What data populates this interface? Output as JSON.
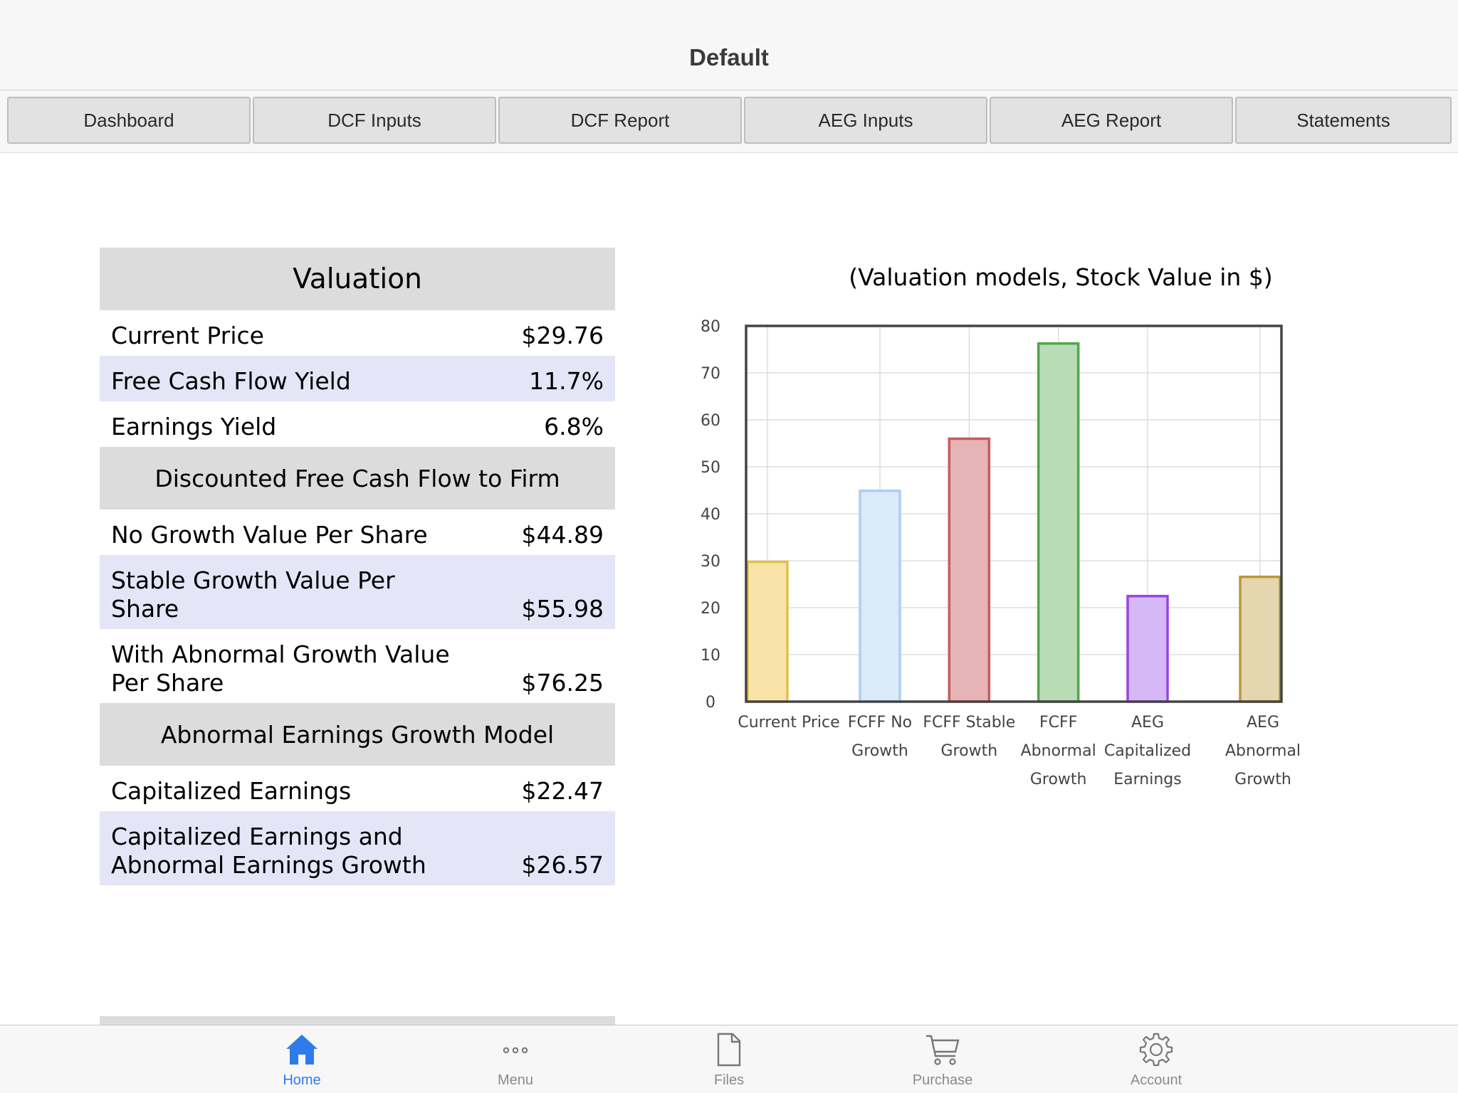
{
  "header": {
    "title": "Default"
  },
  "tabs": [
    {
      "label": "Dashboard"
    },
    {
      "label": "DCF Inputs"
    },
    {
      "label": "DCF Report"
    },
    {
      "label": "AEG Inputs"
    },
    {
      "label": "AEG Report"
    },
    {
      "label": "Statements"
    }
  ],
  "valuation": {
    "title": "Valuation",
    "current_price": {
      "label": "Current Price",
      "value": "$29.76"
    },
    "fcf_yield": {
      "label": "Free Cash Flow Yield",
      "value": "11.7%"
    },
    "earnings_yield": {
      "label": "Earnings Yield",
      "value": "6.8%"
    },
    "dcf_heading": "Discounted Free Cash Flow to Firm",
    "no_growth": {
      "label": "No Growth Value Per Share",
      "value": "$44.89"
    },
    "stable_growth": {
      "label": "Stable Growth Value Per Share",
      "value": "$55.98"
    },
    "abnormal_growth": {
      "label": "With Abnormal Growth Value Per Share",
      "value": "$76.25"
    },
    "aeg_heading": "Abnormal Earnings Growth Model",
    "capitalized": {
      "label": "Capitalized Earnings",
      "value": "$22.47"
    },
    "capitalized_aeg": {
      "label": "Capitalized Earnings and Abnormal Earnings Growth",
      "value": "$26.57"
    }
  },
  "chart_data": {
    "type": "bar",
    "title": "(Valuation models, Stock Value in $)",
    "categories": [
      [
        "Current Price"
      ],
      [
        "FCFF No",
        "Growth"
      ],
      [
        "FCFF Stable",
        "Growth"
      ],
      [
        "FCFF",
        "Abnormal",
        "Growth"
      ],
      [
        "AEG",
        "Capitalized",
        "Earnings"
      ],
      [
        "AEG",
        "Abnormal",
        "Growth"
      ]
    ],
    "values": [
      29.76,
      44.89,
      55.98,
      76.25,
      22.47,
      26.57
    ],
    "ylim": [
      0,
      80
    ],
    "yticks": [
      0,
      10,
      20,
      30,
      40,
      50,
      60,
      70,
      80
    ],
    "grid": true,
    "legend": "none",
    "colors": [
      {
        "fill": "#f8e4a8",
        "stroke": "#e2c04a"
      },
      {
        "fill": "#dbeaf8",
        "stroke": "#a9cff2"
      },
      {
        "fill": "#e6b4b6",
        "stroke": "#c85a5e"
      },
      {
        "fill": "#b9dcb6",
        "stroke": "#4ea84a"
      },
      {
        "fill": "#d6b8f6",
        "stroke": "#9a44e4"
      },
      {
        "fill": "#e4d6ae",
        "stroke": "#b9983a"
      }
    ]
  },
  "bottom_nav": [
    {
      "label": "Home",
      "icon": "home-icon",
      "active": true
    },
    {
      "label": "Menu",
      "icon": "more-icon",
      "active": false
    },
    {
      "label": "Files",
      "icon": "file-icon",
      "active": false
    },
    {
      "label": "Purchase",
      "icon": "cart-icon",
      "active": false
    },
    {
      "label": "Account",
      "icon": "gear-icon",
      "active": false
    }
  ],
  "accent_color": "#2f7bea"
}
